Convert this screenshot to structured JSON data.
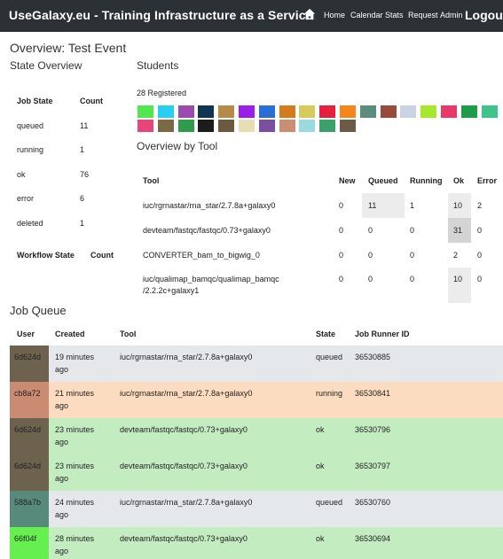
{
  "nav": {
    "brand": "UseGalaxy.eu - Training Infrastructure as a Service",
    "links": [
      "Home",
      "Calendar",
      "Stats",
      "Request",
      "Admin"
    ],
    "logout": "Logout"
  },
  "overview_title": "Overview: Test Event",
  "state_overview": {
    "title": "State Overview",
    "headers": [
      "Job State",
      "Count"
    ],
    "rows": [
      {
        "state": "queued",
        "count": "11"
      },
      {
        "state": "running",
        "count": "1"
      },
      {
        "state": "ok",
        "count": "76"
      },
      {
        "state": "error",
        "count": "6"
      },
      {
        "state": "deleted",
        "count": "1"
      }
    ],
    "workflow_headers": [
      "Workflow State",
      "Count"
    ]
  },
  "students": {
    "title": "Students",
    "registered": "28 Registered",
    "colors": [
      "#4fe84f",
      "#27d0f2",
      "#9b4bb0",
      "#0f3552",
      "#b88a4a",
      "#9b1fe6",
      "#2a6fd4",
      "#d57b1e",
      "#d7cb5a",
      "#e6213f",
      "#f6861c",
      "#5a8d7b",
      "#9a4a3a",
      "#c9d3e5",
      "#a5e82c",
      "#e8396a",
      "#1f9c4a",
      "#3ec48a",
      "#e8467a",
      "#7b6a45",
      "#2e9c4a",
      "#1c1c1c",
      "#6b5a3e",
      "#e6dfb4",
      "#7a4fa0",
      "#cc8e72",
      "#9adbe0",
      "#3ca06a",
      "#6b5a45"
    ]
  },
  "overview_by_tool": {
    "title": "Overview by Tool",
    "headers": [
      "Tool",
      "New",
      "Queued",
      "Running",
      "Ok",
      "Error"
    ],
    "rows": [
      {
        "tool": [
          "iuc/rgrnastar/rna_star/2.7.8a+galaxy0"
        ],
        "new": "0",
        "queued": "11",
        "running": "1",
        "ok": "10",
        "error": "2"
      },
      {
        "tool": [
          "devteam/fastqc/fastqc/0.73+galaxy0"
        ],
        "new": "0",
        "queued": "0",
        "running": "0",
        "ok": "31",
        "error": "0"
      },
      {
        "tool": [
          "CONVERTER_bam_to_bigwig_0"
        ],
        "new": "0",
        "queued": "0",
        "running": "0",
        "ok": "2",
        "error": "0"
      },
      {
        "tool": [
          "iuc/qualimap_bamqc/qualimap_bamqc",
          "/2.2.2c+galaxy1"
        ],
        "new": "0",
        "queued": "0",
        "running": "0",
        "ok": "10",
        "error": "0"
      }
    ]
  },
  "job_queue": {
    "title": "Job Queue",
    "headers": [
      "User",
      "Created",
      "Tool",
      "State",
      "Job Runner ID"
    ],
    "rows": [
      {
        "user": "6d624d",
        "user_color": "#6d624d",
        "created": [
          "19 minutes",
          "ago"
        ],
        "tool": "iuc/rgrnastar/rna_star/2.7.8a+galaxy0",
        "state": "queued",
        "runner_id": "36530885",
        "row_color": "#e5e8eb"
      },
      {
        "user": "cb8a72",
        "user_color": "#cb8a72",
        "created": [
          "21 minutes",
          "ago"
        ],
        "tool": "iuc/rgrnastar/rna_star/2.7.8a+galaxy0",
        "state": "running",
        "runner_id": "36530841",
        "row_color": "#fbdcc0"
      },
      {
        "user": "6d624d",
        "user_color": "#6d624d",
        "created": [
          "23 minutes",
          "ago"
        ],
        "tool": "devteam/fastqc/fastqc/0.73+galaxy0",
        "state": "ok",
        "runner_id": "36530796",
        "row_color": "#c4ecc1"
      },
      {
        "user": "6d624d",
        "user_color": "#6d624d",
        "created": [
          "23 minutes",
          "ago"
        ],
        "tool": "devteam/fastqc/fastqc/0.73+galaxy0",
        "state": "ok",
        "runner_id": "36530797",
        "row_color": "#c4ecc1"
      },
      {
        "user": "588a7b",
        "user_color": "#588a7b",
        "created": [
          "24 minutes",
          "ago"
        ],
        "tool": "iuc/rgrnastar/rna_star/2.7.8a+galaxy0",
        "state": "queued",
        "runner_id": "36530760",
        "row_color": "#e5e8eb"
      },
      {
        "user": "66f04f",
        "user_color": "#66f04f",
        "created": [
          "28 minutes",
          "ago"
        ],
        "tool": "devteam/fastqc/fastqc/0.73+galaxy0",
        "state": "ok",
        "runner_id": "36530694",
        "row_color": "#c4ecc1"
      }
    ]
  }
}
